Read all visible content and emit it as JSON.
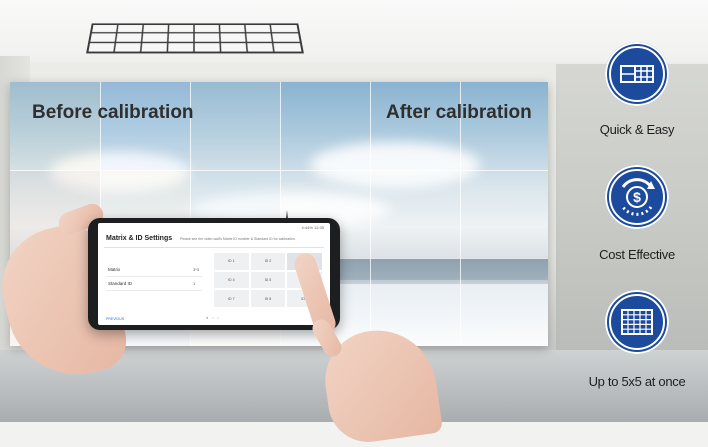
{
  "wall": {
    "before_label": "Before calibration",
    "after_label": "After calibration"
  },
  "phone": {
    "status": "4:44% 12:35",
    "title": "Matrix & ID Settings",
    "hint": "Please see the video wall's Matrix ID number & Standard ID for calibration.",
    "rows": [
      {
        "label": "Matrix",
        "value": "3*3"
      },
      {
        "label": "Standard ID",
        "value": "1"
      }
    ],
    "id_cells": [
      "ID 1",
      "ID 2",
      "ID 3",
      "ID 4",
      "ID 5",
      "ID 6",
      "ID 7",
      "ID 8",
      "ID 9"
    ],
    "footer_left": "PREVIOUS",
    "footer_right": "NEXT"
  },
  "features": [
    {
      "icon": "display-wall-icon",
      "label": "Quick & Easy"
    },
    {
      "icon": "dollar-cycle-icon",
      "label": "Cost Effective"
    },
    {
      "icon": "grid-5x5-icon",
      "label": "Up to 5x5 at once"
    }
  ],
  "colors": {
    "icon_fill": "#1c4a9c",
    "label_text": "#1f1f1f"
  }
}
